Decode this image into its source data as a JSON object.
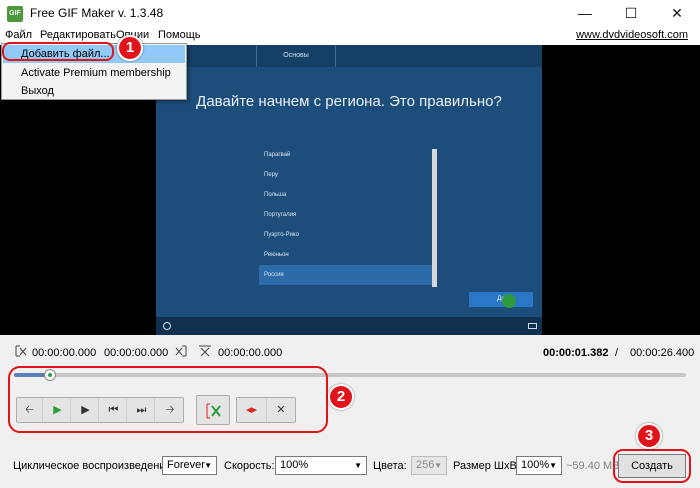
{
  "window": {
    "title": "Free GIF Maker v. 1.3.48",
    "minimize": "—",
    "maximize": "☐",
    "close": "✕",
    "icon_text": "GIF"
  },
  "menu": {
    "file": "Файл",
    "edit": "Редактировать",
    "options": "Опции",
    "help": "Помощь",
    "site": "www.dvdvideosoft.com"
  },
  "file_menu": {
    "add": "Добавить файл...",
    "premium": "Activate Premium membership",
    "exit": "Выход"
  },
  "preview": {
    "tab": "Основы",
    "question": "Давайте начнем с региона. Это правильно?",
    "regions": [
      "Парагвай",
      "Перу",
      "Польша",
      "Португалия",
      "Пуэрто-Рико",
      "Реюньон",
      "Россия"
    ],
    "yes": "Да"
  },
  "markers": {
    "start": "00:00:00.000",
    "end": "00:00:00.000",
    "cut": "00:00:00.000"
  },
  "time": {
    "current": "00:00:01.382",
    "sep": "/",
    "total": "00:00:26.400"
  },
  "playback": {
    "progress_fraction": 0.053
  },
  "settings": {
    "loop_label": "Циклическое воспроизведение:",
    "loop_value": "Forever",
    "speed_label": "Скорость:",
    "speed_value": "100%",
    "colors_label": "Цвета:",
    "colors_value": "256",
    "size_label": "Размер ШxВ:",
    "size_value": "100%",
    "file_size": "~59.40 MB"
  },
  "create": "Создать",
  "badges": [
    "1",
    "2",
    "3"
  ],
  "colors": {
    "accent_red": "#e0141a",
    "highlight": "#91c9f7",
    "preview_bg": "#1d4d7a"
  }
}
